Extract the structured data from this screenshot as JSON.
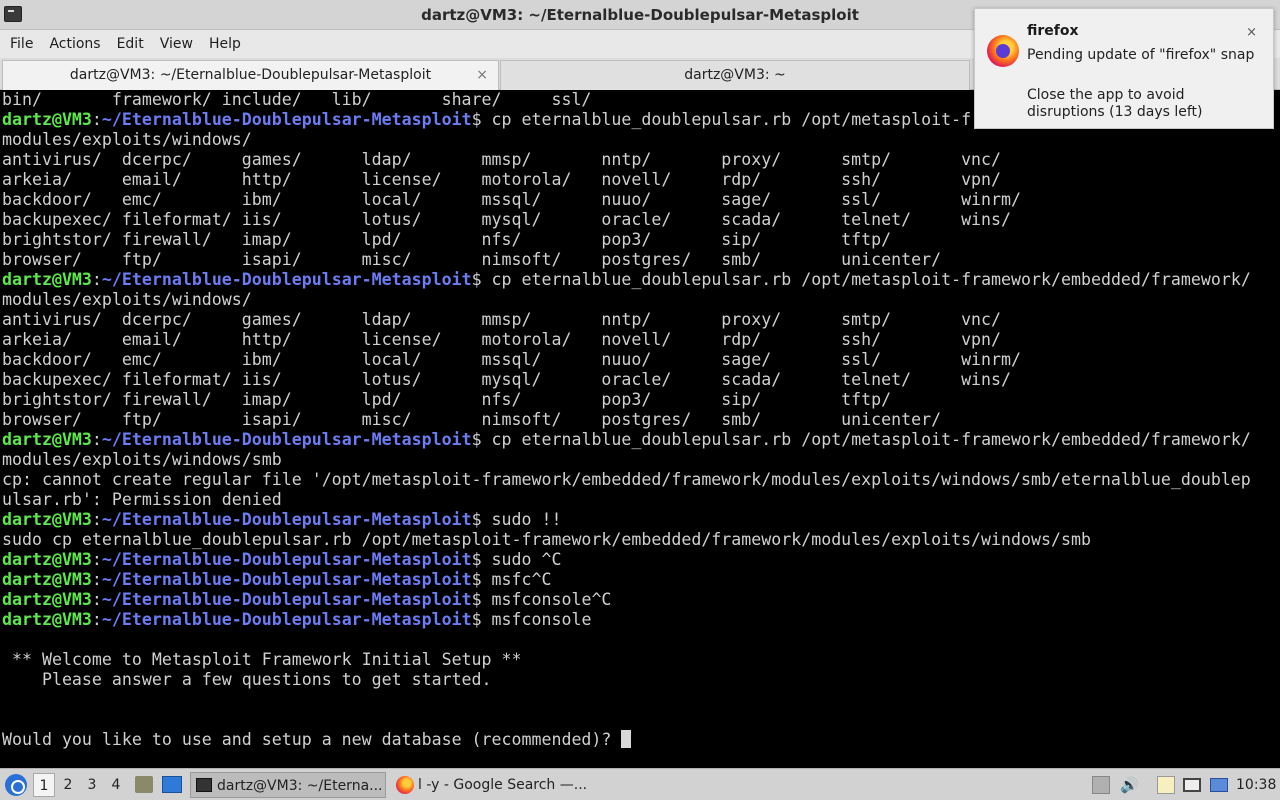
{
  "window": {
    "title": "dartz@VM3: ~/Eternalblue-Doublepulsar-Metasploit"
  },
  "menu": [
    "File",
    "Actions",
    "Edit",
    "View",
    "Help"
  ],
  "tabs": [
    {
      "label": "dartz@VM3: ~/Eternalblue-Doublepulsar-Metasploit",
      "active": true,
      "close": "×"
    },
    {
      "label": "dartz@VM3: ~",
      "active": false
    }
  ],
  "terminal": {
    "lines": [
      {
        "text": "bin/       framework/ include/   lib/       share/     ssl/"
      },
      {
        "user": "dartz@VM3",
        "path": "~/Eternalblue-Doublepulsar-Metasploit",
        "cmd": "$ cp eternalblue_doublepulsar.rb /opt/metasploit-framework/embedded/framework/"
      },
      {
        "text": "modules/exploits/windows/"
      },
      {
        "text": "antivirus/  dcerpc/     games/      ldap/       mmsp/       nntp/       proxy/      smtp/       vnc/"
      },
      {
        "text": "arkeia/     email/      http/       license/    motorola/   novell/     rdp/        ssh/        vpn/"
      },
      {
        "text": "backdoor/   emc/        ibm/        local/      mssql/      nuuo/       sage/       ssl/        winrm/"
      },
      {
        "text": "backupexec/ fileformat/ iis/        lotus/      mysql/      oracle/     scada/      telnet/     wins/"
      },
      {
        "text": "brightstor/ firewall/   imap/       lpd/        nfs/        pop3/       sip/        tftp/"
      },
      {
        "text": "browser/    ftp/        isapi/      misc/       nimsoft/    postgres/   smb/        unicenter/"
      },
      {
        "user": "dartz@VM3",
        "path": "~/Eternalblue-Doublepulsar-Metasploit",
        "cmd": "$ cp eternalblue_doublepulsar.rb /opt/metasploit-framework/embedded/framework/"
      },
      {
        "text": "modules/exploits/windows/"
      },
      {
        "text": "antivirus/  dcerpc/     games/      ldap/       mmsp/       nntp/       proxy/      smtp/       vnc/"
      },
      {
        "text": "arkeia/     email/      http/       license/    motorola/   novell/     rdp/        ssh/        vpn/"
      },
      {
        "text": "backdoor/   emc/        ibm/        local/      mssql/      nuuo/       sage/       ssl/        winrm/"
      },
      {
        "text": "backupexec/ fileformat/ iis/        lotus/      mysql/      oracle/     scada/      telnet/     wins/"
      },
      {
        "text": "brightstor/ firewall/   imap/       lpd/        nfs/        pop3/       sip/        tftp/"
      },
      {
        "text": "browser/    ftp/        isapi/      misc/       nimsoft/    postgres/   smb/        unicenter/"
      },
      {
        "user": "dartz@VM3",
        "path": "~/Eternalblue-Doublepulsar-Metasploit",
        "cmd": "$ cp eternalblue_doublepulsar.rb /opt/metasploit-framework/embedded/framework/"
      },
      {
        "text": "modules/exploits/windows/smb"
      },
      {
        "text": "cp: cannot create regular file '/opt/metasploit-framework/embedded/framework/modules/exploits/windows/smb/eternalblue_doublep"
      },
      {
        "text": "ulsar.rb': Permission denied"
      },
      {
        "user": "dartz@VM3",
        "path": "~/Eternalblue-Doublepulsar-Metasploit",
        "cmd": "$ sudo !!"
      },
      {
        "text": "sudo cp eternalblue_doublepulsar.rb /opt/metasploit-framework/embedded/framework/modules/exploits/windows/smb"
      },
      {
        "user": "dartz@VM3",
        "path": "~/Eternalblue-Doublepulsar-Metasploit",
        "cmd": "$ sudo ^C"
      },
      {
        "user": "dartz@VM3",
        "path": "~/Eternalblue-Doublepulsar-Metasploit",
        "cmd": "$ msfc^C"
      },
      {
        "user": "dartz@VM3",
        "path": "~/Eternalblue-Doublepulsar-Metasploit",
        "cmd": "$ msfconsole^C"
      },
      {
        "user": "dartz@VM3",
        "path": "~/Eternalblue-Doublepulsar-Metasploit",
        "cmd": "$ msfconsole"
      },
      {
        "text": ""
      },
      {
        "text": " ** Welcome to Metasploit Framework Initial Setup **"
      },
      {
        "text": "    Please answer a few questions to get started."
      },
      {
        "text": ""
      },
      {
        "text": ""
      },
      {
        "text": "Would you like to use and setup a new database (recommended)? ",
        "cursor": true
      }
    ],
    "colors": {
      "user": "#5ee84e",
      "path": "#6b7cf4",
      "text": "#d0d0d0",
      "background": "#000000"
    }
  },
  "notification": {
    "app": "firefox",
    "icon": "firefox-icon",
    "body1": "Pending update of \"firefox\" snap",
    "body2": "Close the app to avoid disruptions (13 days left)",
    "close": "×"
  },
  "taskbar": {
    "workspaces": [
      "1",
      "2",
      "3",
      "4"
    ],
    "active_workspace": "1",
    "tasks": [
      {
        "label": "dartz@VM3: ~/Eterna...",
        "icon": "terminal-icon",
        "active": true
      },
      {
        "label": "l -y - Google Search —...",
        "icon": "firefox-icon",
        "active": false
      }
    ],
    "volume_glyph": "🔊",
    "clock": "10:38"
  }
}
